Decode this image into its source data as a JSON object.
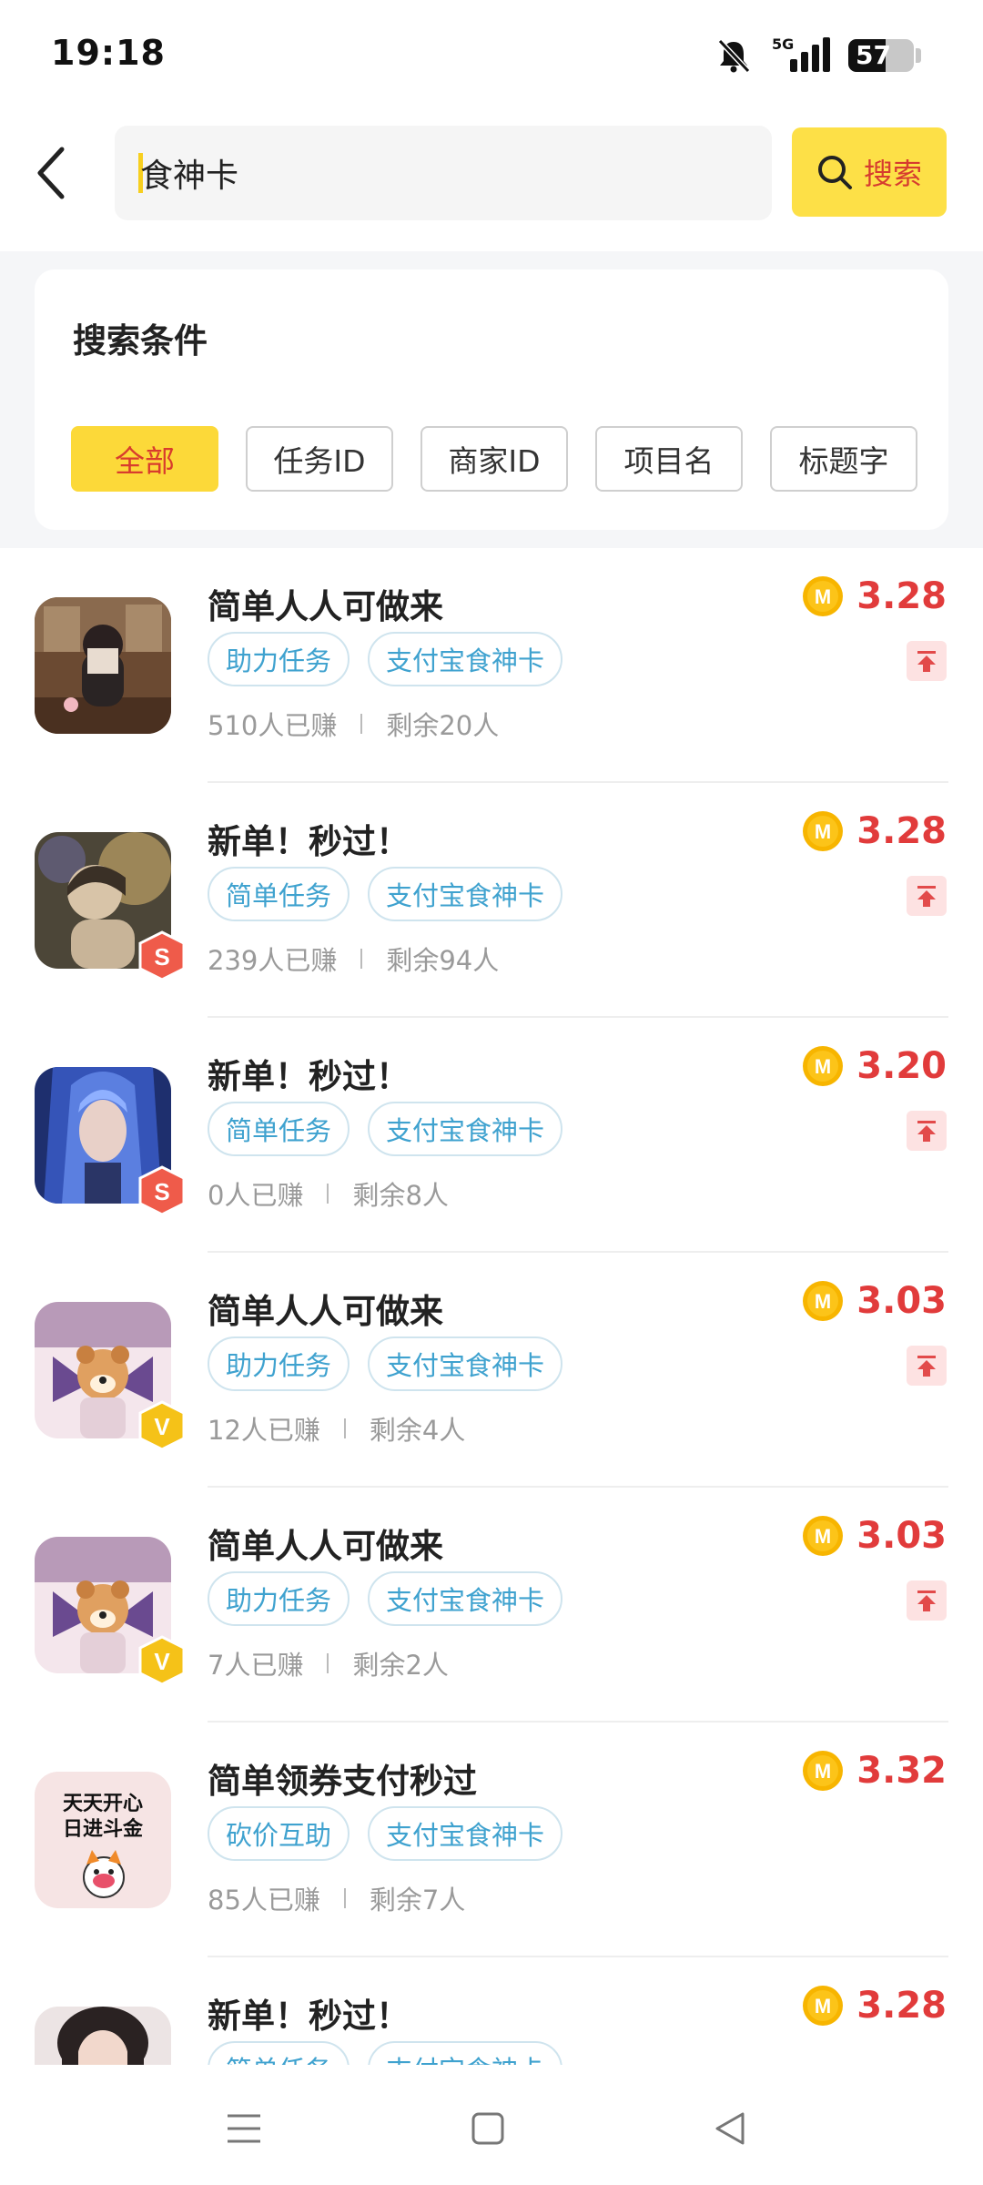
{
  "status_bar": {
    "time": "19:18",
    "network": "5G",
    "battery": "57"
  },
  "header": {
    "search_value": "食神卡",
    "search_button": "搜索"
  },
  "filter": {
    "title": "搜索条件",
    "chips": [
      {
        "label": "全部",
        "active": true
      },
      {
        "label": "任务ID",
        "active": false
      },
      {
        "label": "商家ID",
        "active": false
      },
      {
        "label": "项目名",
        "active": false
      },
      {
        "label": "标题字",
        "active": false
      }
    ]
  },
  "tasks": [
    {
      "title": "简单人人可做来",
      "tags": [
        "助力任务",
        "支付宝食神卡"
      ],
      "earned": "510人已赚",
      "remaining": "剩余20人",
      "price": "3.28",
      "badge": "",
      "avatar_theme": "girl-photo"
    },
    {
      "title": "新单！秒过！",
      "tags": [
        "简单任务",
        "支付宝食神卡"
      ],
      "earned": "239人已赚",
      "remaining": "剩余94人",
      "price": "3.28",
      "badge": "S",
      "avatar_theme": "portrait-gold"
    },
    {
      "title": "新单！秒过！",
      "tags": [
        "简单任务",
        "支付宝食神卡"
      ],
      "earned": "0人已赚",
      "remaining": "剩余8人",
      "price": "3.20",
      "badge": "S",
      "avatar_theme": "anime-blue"
    },
    {
      "title": "简单人人可做来",
      "tags": [
        "助力任务",
        "支付宝食神卡"
      ],
      "earned": "12人已赚",
      "remaining": "剩余4人",
      "price": "3.03",
      "badge": "V",
      "avatar_theme": "anime-dog"
    },
    {
      "title": "简单人人可做来",
      "tags": [
        "助力任务",
        "支付宝食神卡"
      ],
      "earned": "7人已赚",
      "remaining": "剩余2人",
      "price": "3.03",
      "badge": "V",
      "avatar_theme": "anime-dog"
    },
    {
      "title": "简单领券支付秒过",
      "tags": [
        "砍价互助",
        "支付宝食神卡"
      ],
      "earned": "85人已赚",
      "remaining": "剩余7人",
      "price": "3.32",
      "badge": "",
      "avatar_theme": "text-logo",
      "avatar_text": [
        "天天开心",
        "日进斗金"
      ]
    },
    {
      "title": "新单！秒过！",
      "tags": [
        "简单任务",
        "支付宝食神卡"
      ],
      "earned": "",
      "remaining": "",
      "price": "3.28",
      "badge": "",
      "avatar_theme": "girl-portrait"
    }
  ],
  "colors": {
    "accent_yellow": "#fcd939",
    "price_red": "#e13b3b",
    "tag_blue": "#3fa2cf"
  },
  "icons": {
    "back": "chevron-left-icon",
    "search": "search-icon",
    "coin": "coin-m-icon",
    "pin": "pin-top-icon"
  }
}
